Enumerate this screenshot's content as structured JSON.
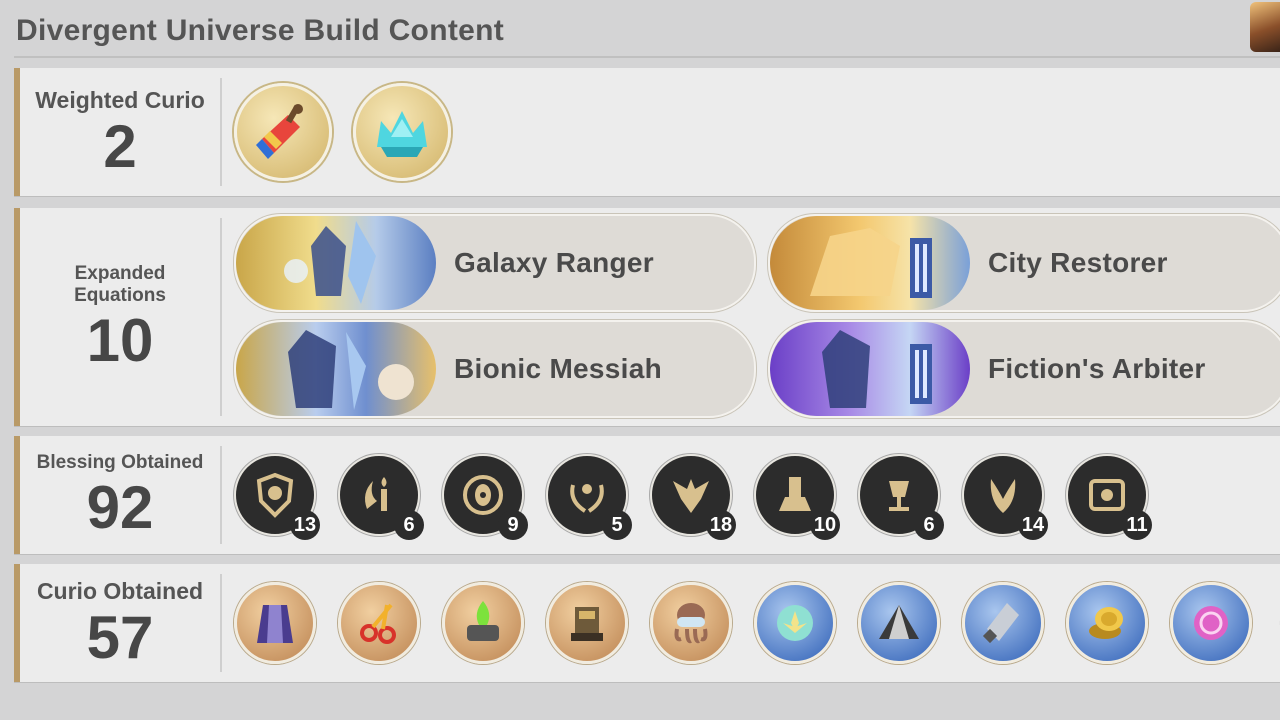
{
  "page_title": "Divergent Universe Build Content",
  "sections": {
    "weighted_curio": {
      "label": "Weighted Curio",
      "value": "2",
      "items": [
        {
          "icon": "firecracker-curio-icon"
        },
        {
          "icon": "crystal-crown-curio-icon"
        }
      ]
    },
    "expanded_equations": {
      "label": "Expanded Equations",
      "value": "10",
      "items": [
        {
          "name": "Galaxy Ranger",
          "frame": "gold"
        },
        {
          "name": "City Restorer",
          "frame": "gold"
        },
        {
          "name": "Bionic Messiah",
          "frame": "gold"
        },
        {
          "name": "Fiction's Arbiter",
          "frame": "purple"
        }
      ]
    },
    "blessing_obtained": {
      "label": "Blessing Obtained",
      "value": "92",
      "items": [
        {
          "icon": "preservation-path-icon",
          "count": "13"
        },
        {
          "icon": "remembrance-path-icon",
          "count": "6"
        },
        {
          "icon": "nihility-path-icon",
          "count": "9"
        },
        {
          "icon": "abundance-path-icon",
          "count": "5"
        },
        {
          "icon": "hunt-path-icon",
          "count": "18"
        },
        {
          "icon": "destruction-path-icon",
          "count": "10"
        },
        {
          "icon": "elation-path-icon",
          "count": "6"
        },
        {
          "icon": "propagation-path-icon",
          "count": "14"
        },
        {
          "icon": "erudition-path-icon",
          "count": "11"
        }
      ]
    },
    "curio_obtained": {
      "label": "Curio Obtained",
      "value": "57",
      "more": "···",
      "items": [
        {
          "icon": "cloak-curio-icon",
          "tone": "bronze"
        },
        {
          "icon": "scissors-curio-icon",
          "tone": "bronze"
        },
        {
          "icon": "green-flame-curio-icon",
          "tone": "bronze"
        },
        {
          "icon": "machine-curio-icon",
          "tone": "bronze"
        },
        {
          "icon": "octopus-goggles-curio-icon",
          "tone": "bronze"
        },
        {
          "icon": "lotus-orb-curio-icon",
          "tone": "blue"
        },
        {
          "icon": "pyramid-curio-icon",
          "tone": "blue"
        },
        {
          "icon": "paint-tube-curio-icon",
          "tone": "blue"
        },
        {
          "icon": "gold-coins-curio-icon",
          "tone": "blue"
        },
        {
          "icon": "pink-seal-curio-icon",
          "tone": "blue"
        }
      ]
    }
  }
}
